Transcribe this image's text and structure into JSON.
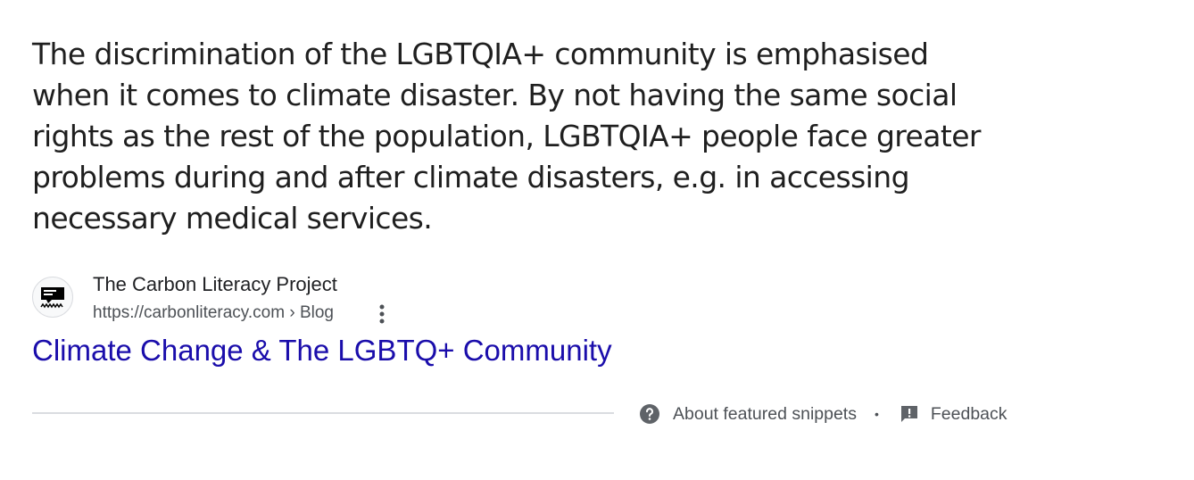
{
  "snippet": {
    "text": "The discrimination of the LGBTQIA+ community is emphasised when it comes to climate disaster. By not having the same social rights as the rest of the population, LGBTQIA+ people face greater problems during and after climate disasters, e.g. in accessing necessary medical services."
  },
  "source": {
    "site_name": "The Carbon Literacy Project",
    "url": "https://carbonliteracy.com › Blog",
    "favicon_icon": "carbon-literacy-logo-icon",
    "more_icon": "more-vert-icon"
  },
  "result": {
    "title": "Climate Change & The LGBTQ+ Community",
    "link_color": "#1a0dab"
  },
  "footer": {
    "about_label": "About featured snippets",
    "separator": "•",
    "feedback_label": "Feedback",
    "about_icon": "help-circle-icon",
    "feedback_icon": "feedback-icon"
  },
  "colors": {
    "text": "#1f1f1f",
    "secondary": "#4d5156",
    "divider": "#dadce0"
  }
}
